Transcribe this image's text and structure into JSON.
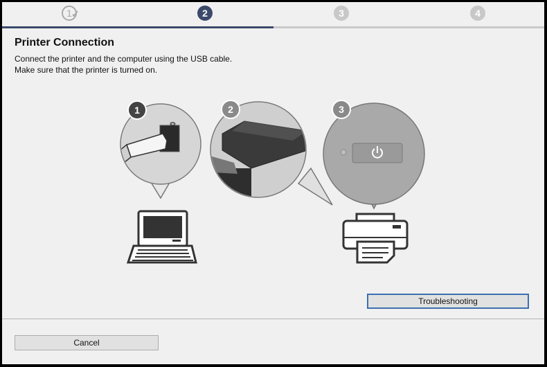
{
  "steps": [
    {
      "number": "1",
      "state": "done"
    },
    {
      "number": "2",
      "state": "active"
    },
    {
      "number": "3",
      "state": "pending"
    },
    {
      "number": "4",
      "state": "pending"
    }
  ],
  "progress": 0.5,
  "page": {
    "title": "Printer Connection",
    "line1": "Connect the printer and the computer using the USB cable.",
    "line2": "Make sure that the printer is turned on."
  },
  "illustration": {
    "badge1": "1",
    "badge2": "2",
    "badge3": "3",
    "usb_symbol": "⭖"
  },
  "buttons": {
    "troubleshooting": "Troubleshooting",
    "cancel": "Cancel"
  },
  "colors": {
    "accent": "#3b4a6b",
    "focus_border": "#3c6fb0"
  }
}
